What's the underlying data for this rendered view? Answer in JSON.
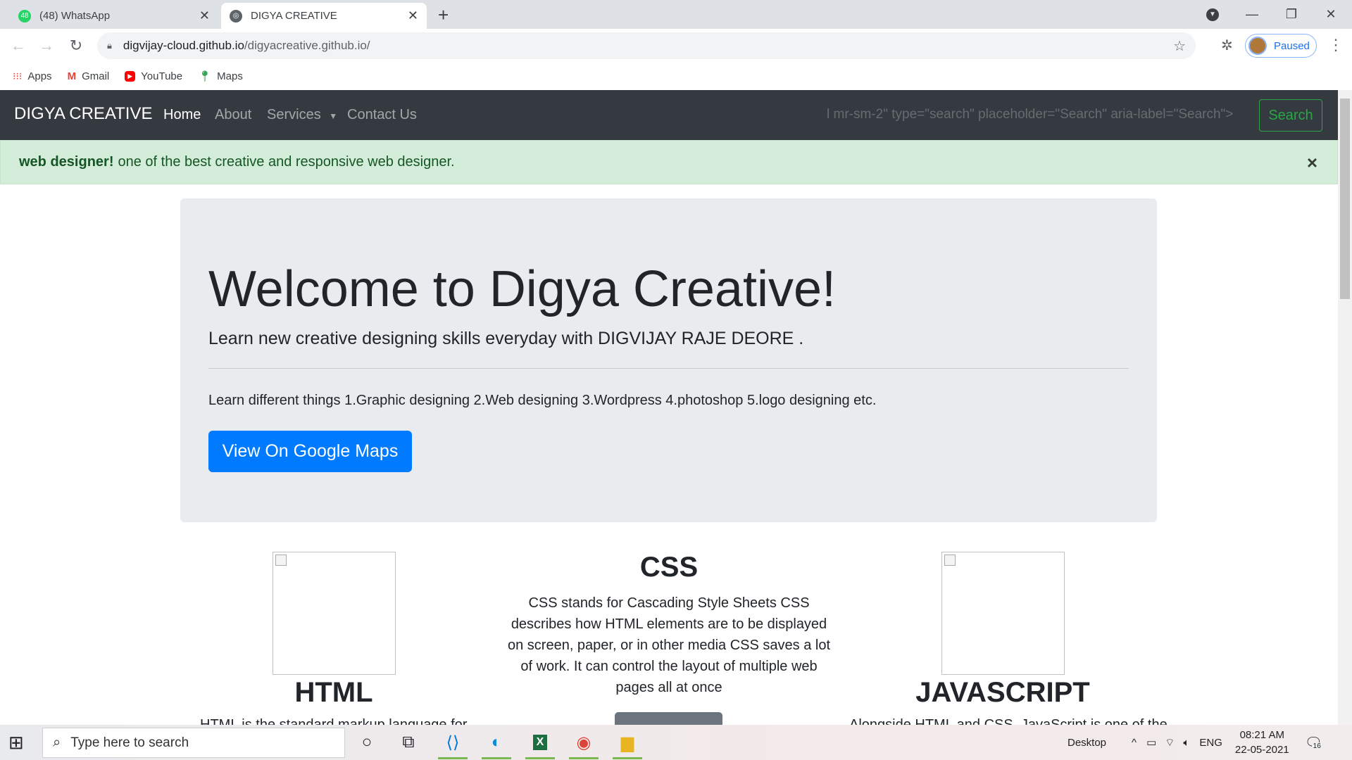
{
  "browser": {
    "tabs": [
      {
        "title": "(48) WhatsApp",
        "badge": "48",
        "icon": "whatsapp-icon",
        "active": false
      },
      {
        "title": "DIGYA CREATIVE",
        "icon": "globe-icon",
        "active": true
      }
    ],
    "url_host": "digvijay-cloud.github.io",
    "url_path": "/digyacreative.github.io/",
    "profile_status": "Paused",
    "bookmarks": [
      {
        "label": "Apps",
        "icon": "apps-grid-icon"
      },
      {
        "label": "Gmail",
        "icon": "gmail-icon"
      },
      {
        "label": "YouTube",
        "icon": "youtube-icon"
      },
      {
        "label": "Maps",
        "icon": "maps-icon"
      }
    ]
  },
  "site": {
    "brand": "DIGYA CREATIVE",
    "nav": {
      "home": "Home",
      "about": "About",
      "services": "Services",
      "contact": "Contact Us"
    },
    "broken_input_text": "l mr-sm-2\" type=\"search\" placeholder=\"Search\" aria-label=\"Search\">",
    "search_button": "Search",
    "alert": {
      "strong": "web designer!",
      "text": "one of the best creative and responsive web designer.",
      "close": "×"
    },
    "jumbotron": {
      "title": "Welcome to Digya Creative!",
      "lead": "Learn new creative designing skills everyday with DIGVIJAY RAJE DEORE .",
      "text": "Learn different things 1.Graphic designing 2.Web designing 3.Wordpress 4.photoshop 5.logo designing etc.",
      "button": "View On Google Maps"
    },
    "columns": {
      "html_title": "HTML",
      "html_text_cut": "HTML is the standard markup language for",
      "css_title": "CSS",
      "css_text": "CSS stands for Cascading Style Sheets CSS describes how HTML elements are to be displayed on screen, paper, or in other media CSS saves a lot of work. It can control the layout of multiple web pages all at once",
      "js_title": "JAVASCRIPT",
      "js_text_cut": "Alongside HTML and CSS, JavaScript is one of the"
    }
  },
  "taskbar": {
    "search_placeholder": "Type here to search",
    "desktop_label": "Desktop",
    "language": "ENG",
    "time": "08:21 AM",
    "date": "22-05-2021",
    "notification_count": "16"
  }
}
